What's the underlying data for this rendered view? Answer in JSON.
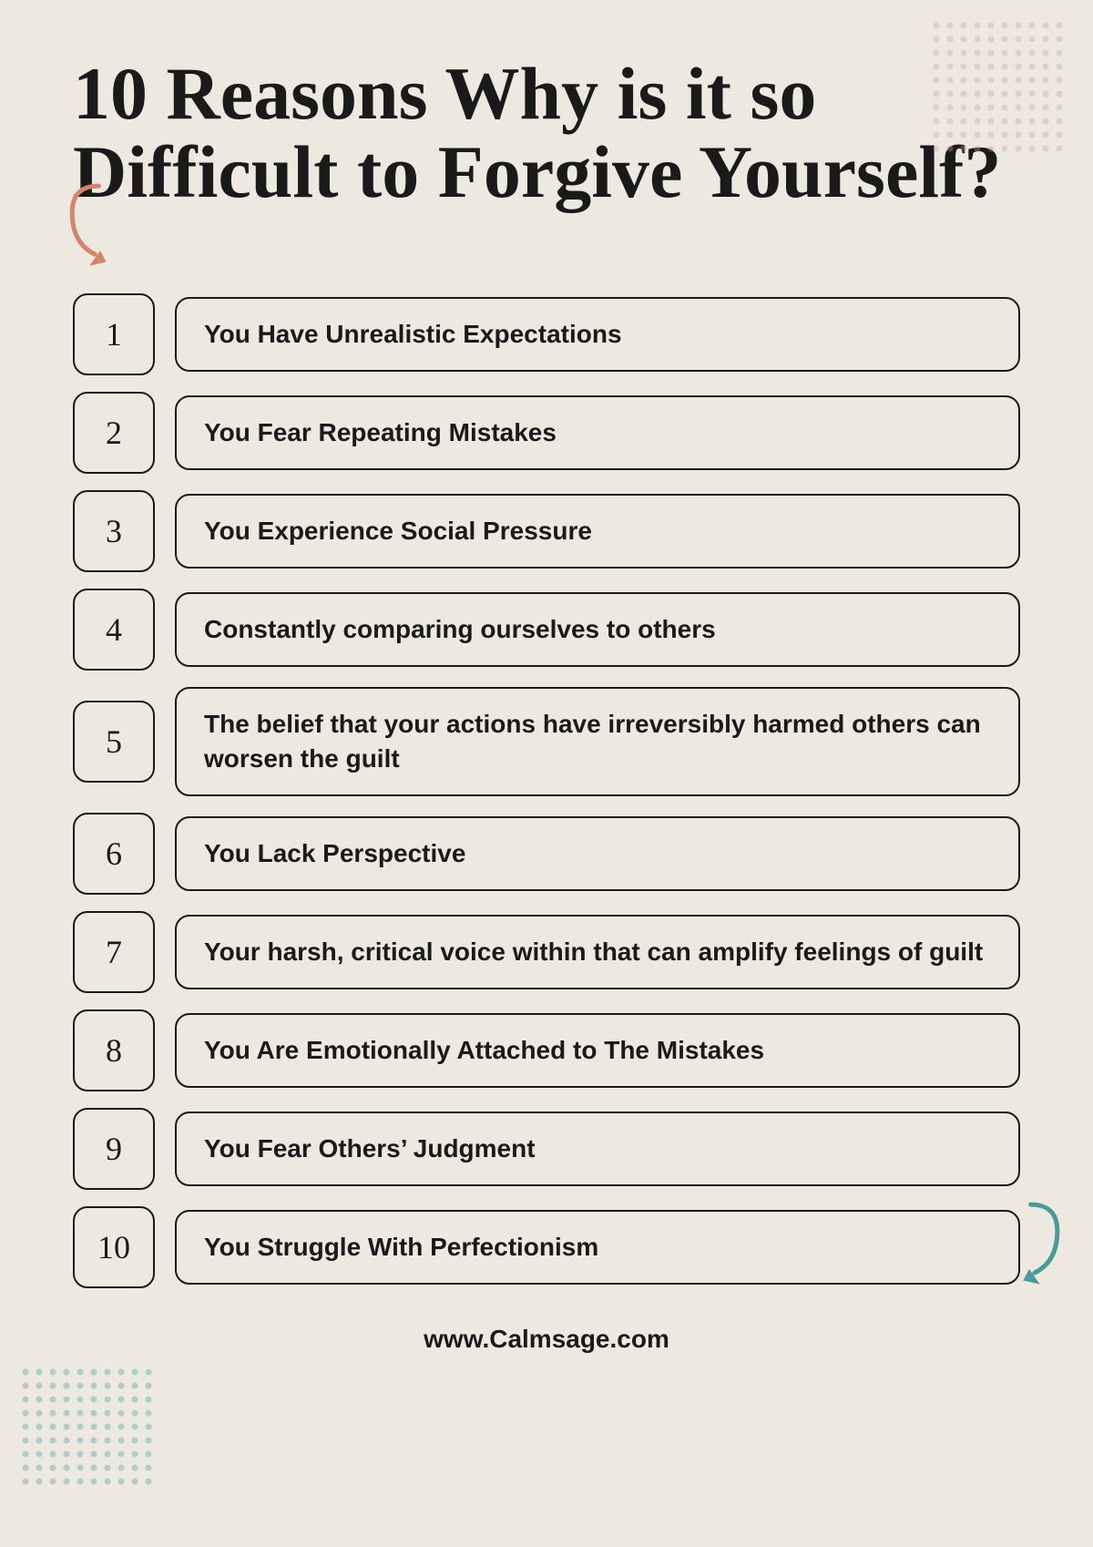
{
  "page": {
    "title_line1": "10 Reasons Why is it so",
    "title_line2": "Difficult to Forgive Yourself?",
    "background_color": "#ede8e0",
    "footer_url": "www.Calmsage.com"
  },
  "items": [
    {
      "number": "1",
      "text": "You Have Unrealistic Expectations"
    },
    {
      "number": "2",
      "text": "You Fear Repeating Mistakes"
    },
    {
      "number": "3",
      "text": "You Experience Social Pressure"
    },
    {
      "number": "4",
      "text": "Constantly comparing ourselves to others"
    },
    {
      "number": "5",
      "text": "The belief that your actions have irreversibly harmed others can worsen the guilt"
    },
    {
      "number": "6",
      "text": "You Lack Perspective"
    },
    {
      "number": "7",
      "text": "Your harsh, critical voice within that can amplify feelings of guilt"
    },
    {
      "number": "8",
      "text": "You Are Emotionally Attached to The Mistakes"
    },
    {
      "number": "9",
      "text": "You Fear Others’ Judgment"
    },
    {
      "number": "10",
      "text": "You Struggle With Perfectionism"
    }
  ],
  "decorations": {
    "salmon_arrow": "↓",
    "teal_arrow": "↓"
  }
}
